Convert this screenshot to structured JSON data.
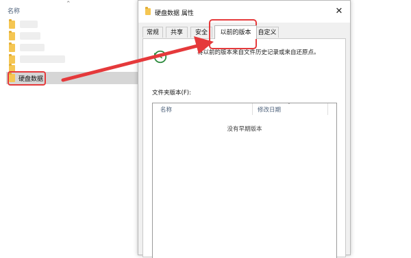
{
  "explorer": {
    "column_header": "名称",
    "selected_item": "硬盘数据"
  },
  "dialog": {
    "title": "硬盘数据 属性",
    "close_glyph": "✕",
    "tabs": [
      {
        "label": "常规"
      },
      {
        "label": "共享"
      },
      {
        "label": "安全"
      },
      {
        "label": "以前的版本"
      },
      {
        "label": "自定义"
      }
    ],
    "active_tab": "以前的版本",
    "description": "将以前的版本来自文件历史记录或来自还原点。",
    "versions_label": "文件夹版本(F):",
    "versions_label_key": "F",
    "columns": [
      {
        "label": "名称"
      },
      {
        "label": "修改日期"
      }
    ],
    "empty_message": "没有早期版本"
  },
  "colors": {
    "annotation": "#e5393b",
    "folder": "#f5c652",
    "selection": "#d6d6d6"
  }
}
